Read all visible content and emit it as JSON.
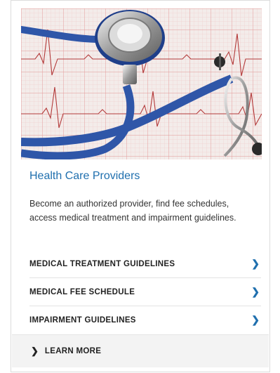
{
  "card": {
    "image_alt": "stethoscope on ECG paper",
    "title": "Health Care Providers",
    "description": "Become an authorized provider, find fee schedules, access medical treatment and impairment guidelines.",
    "links": [
      {
        "label": "MEDICAL TREATMENT GUIDELINES",
        "icon": "chevron-right-icon"
      },
      {
        "label": "MEDICAL FEE SCHEDULE",
        "icon": "chevron-right-icon"
      },
      {
        "label": "IMPAIRMENT GUIDELINES",
        "icon": "chevron-right-icon"
      }
    ],
    "learn_more": {
      "label": "LEARN MORE",
      "icon": "chevron-right-icon"
    }
  },
  "colors": {
    "accent": "#1f6fae",
    "text": "#222222",
    "border": "#dcdcdc",
    "footer_bg": "#f3f3f3"
  }
}
